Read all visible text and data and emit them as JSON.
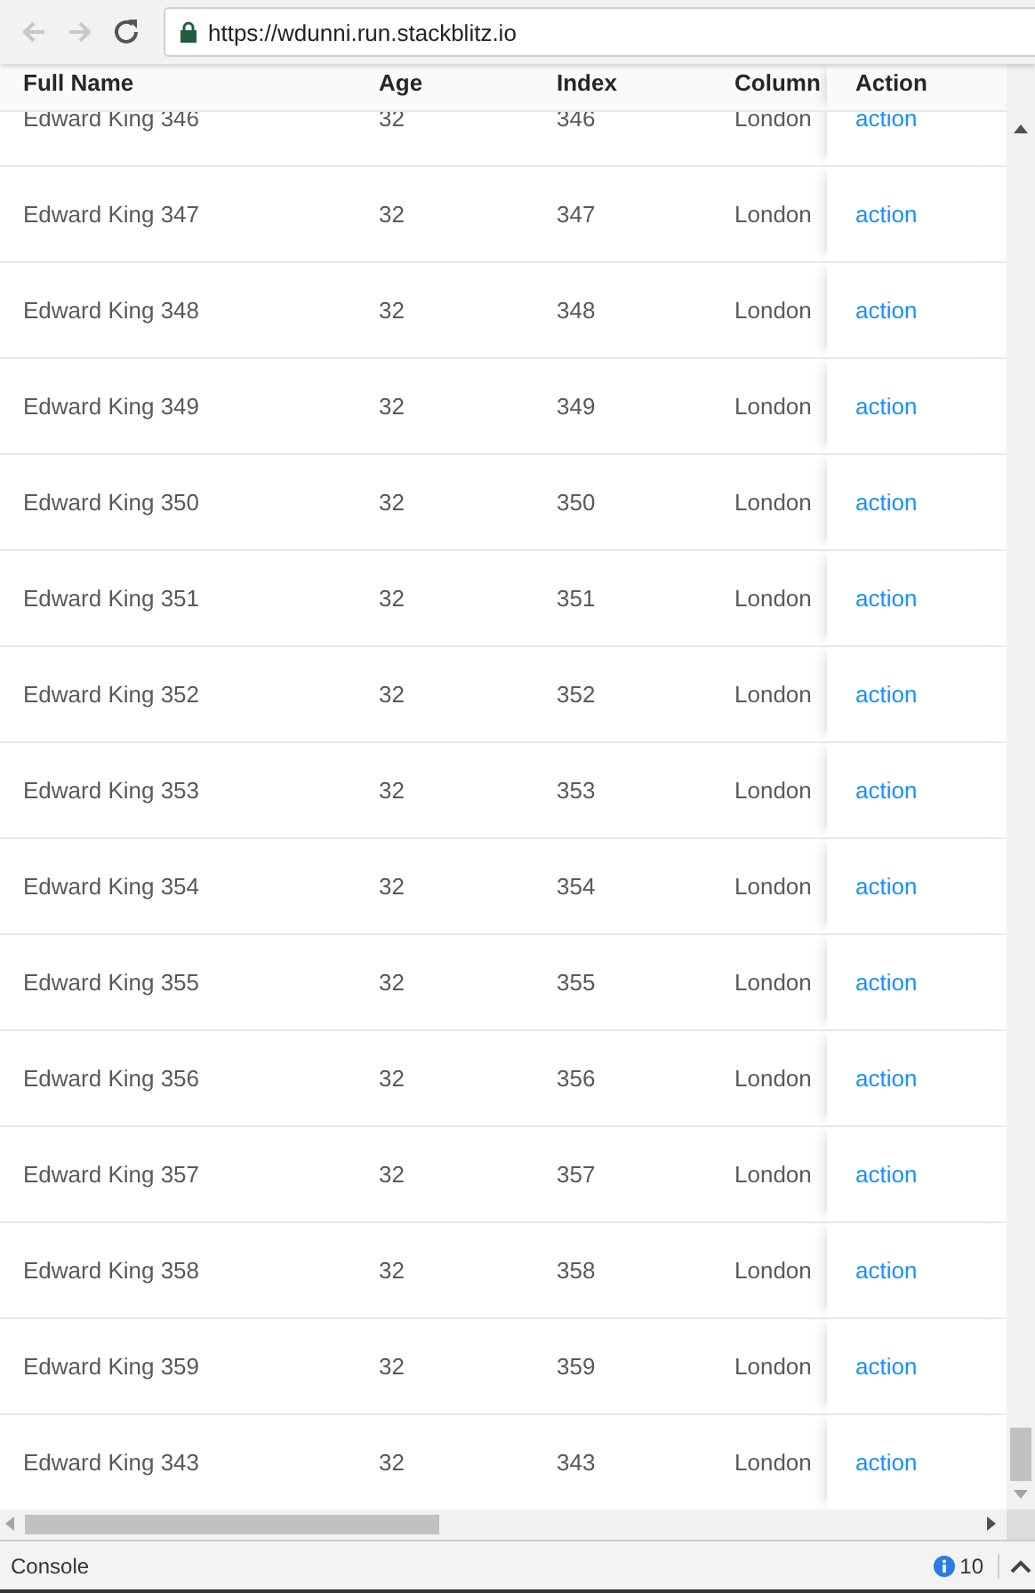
{
  "browser": {
    "url": "https://wdunni.run.stackblitz.io"
  },
  "table": {
    "columns": [
      "Full Name",
      "Age",
      "Index",
      "Column",
      "Action"
    ],
    "rows": [
      {
        "name": "Edward King 346",
        "age": "32",
        "index": "346",
        "city": "London",
        "action": "action"
      },
      {
        "name": "Edward King 347",
        "age": "32",
        "index": "347",
        "city": "London",
        "action": "action"
      },
      {
        "name": "Edward King 348",
        "age": "32",
        "index": "348",
        "city": "London",
        "action": "action"
      },
      {
        "name": "Edward King 349",
        "age": "32",
        "index": "349",
        "city": "London",
        "action": "action"
      },
      {
        "name": "Edward King 350",
        "age": "32",
        "index": "350",
        "city": "London",
        "action": "action"
      },
      {
        "name": "Edward King 351",
        "age": "32",
        "index": "351",
        "city": "London",
        "action": "action"
      },
      {
        "name": "Edward King 352",
        "age": "32",
        "index": "352",
        "city": "London",
        "action": "action"
      },
      {
        "name": "Edward King 353",
        "age": "32",
        "index": "353",
        "city": "London",
        "action": "action"
      },
      {
        "name": "Edward King 354",
        "age": "32",
        "index": "354",
        "city": "London",
        "action": "action"
      },
      {
        "name": "Edward King 355",
        "age": "32",
        "index": "355",
        "city": "London",
        "action": "action"
      },
      {
        "name": "Edward King 356",
        "age": "32",
        "index": "356",
        "city": "London",
        "action": "action"
      },
      {
        "name": "Edward King 357",
        "age": "32",
        "index": "357",
        "city": "London",
        "action": "action"
      },
      {
        "name": "Edward King 358",
        "age": "32",
        "index": "358",
        "city": "London",
        "action": "action"
      },
      {
        "name": "Edward King 359",
        "age": "32",
        "index": "359",
        "city": "London",
        "action": "action"
      },
      {
        "name": "Edward King 343",
        "age": "32",
        "index": "343",
        "city": "London",
        "action": "action"
      }
    ]
  },
  "devtools": {
    "tab": "Console",
    "message_count": "10"
  }
}
